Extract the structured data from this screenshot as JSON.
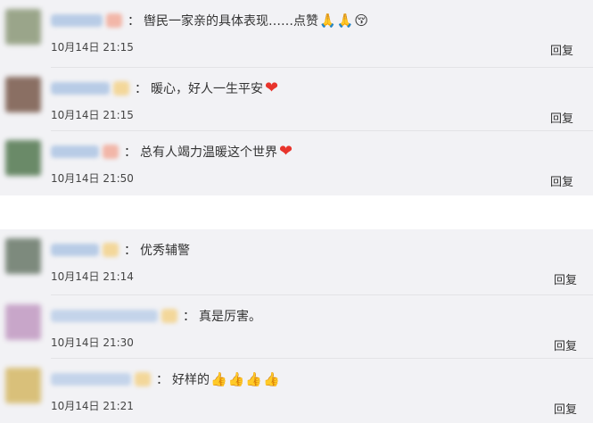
{
  "reply_label": "回复",
  "group_top": [
    {
      "text": "辔民一家亲的具体表现……点赞",
      "emojis": [
        "🙏",
        "🙏",
        "😚"
      ],
      "time": "10月14日 21:15",
      "avatar_color": "#9aa58a",
      "badge_color": "#f2b6a8"
    },
    {
      "text": "暖心，好人一生平安",
      "emojis": [
        "❤"
      ],
      "time": "10月14日 21:15",
      "avatar_color": "#8a6f63",
      "badge_color": "#f3d79a"
    },
    {
      "text": "总有人竭力温暖这个世界",
      "emojis": [
        "❤"
      ],
      "time": "10月14日 21:50",
      "avatar_color": "#6a8a68",
      "badge_color": "#f2b6a8"
    }
  ],
  "group_bottom": [
    {
      "text": "优秀辅警",
      "emojis": [],
      "time": "10月14日 21:14",
      "avatar_color": "#7d8a7d",
      "badge_color": "#f3d79a"
    },
    {
      "text": "真是厉害。",
      "emojis": [],
      "time": "10月14日 21:30",
      "avatar_color": "#c8a6c9",
      "badge_color": "#f3d79a"
    },
    {
      "text": "好样的",
      "emojis": [
        "👍",
        "👍",
        "👍",
        "👍"
      ],
      "time": "10月14日 21:21",
      "avatar_color": "#d9c07a",
      "badge_color": "#f3d79a"
    }
  ]
}
